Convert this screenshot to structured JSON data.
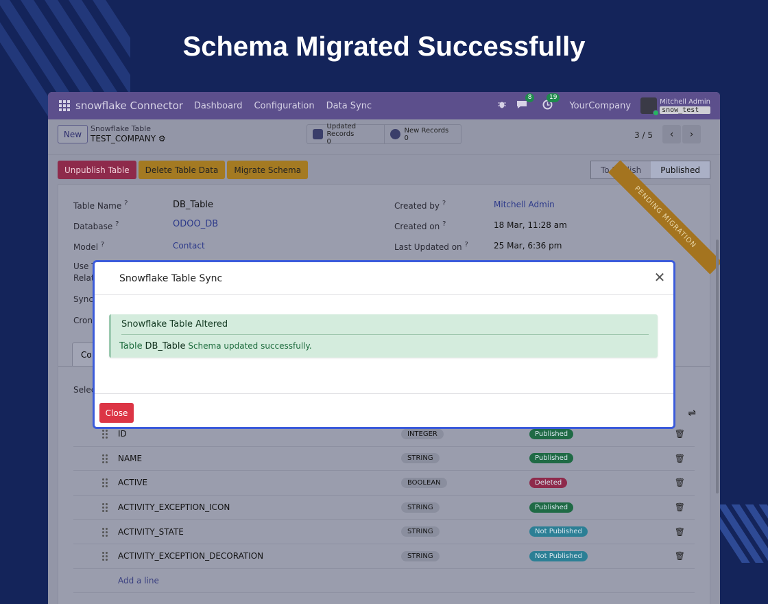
{
  "headline": "Schema Migrated Successfully",
  "navbar": {
    "brand": "snowflake Connector",
    "menu": [
      "Dashboard",
      "Configuration",
      "Data Sync"
    ],
    "messages_count": "8",
    "activities_count": "19",
    "company": "YourCompany",
    "user_name": "Mitchell Admin",
    "db_name": "snow_test",
    "icons": {
      "apps": "apps-grid-icon",
      "debug": "bug-icon",
      "messages": "chat-icon",
      "activities": "clock-icon"
    }
  },
  "control": {
    "new_label": "New",
    "breadcrumb_parent": "Snowflake Table",
    "breadcrumb_current": "TEST_COMPANY",
    "stats": [
      {
        "label": "Updated Records",
        "value": "0",
        "icon": "edit-icon"
      },
      {
        "label": "New Records",
        "value": "0",
        "icon": "plus-circle-icon"
      }
    ],
    "pager_current": "3",
    "pager_total": "/ 5"
  },
  "actions": {
    "unpublish": "Unpublish Table",
    "delete": "Delete Table Data",
    "migrate": "Migrate Schema"
  },
  "statusbar": {
    "to_publish": "To Publish",
    "published": "Published"
  },
  "ribbon": "PENDING MIGRATION",
  "form": {
    "table_name_label": "Table Name",
    "table_name_value": "DB_Table",
    "database_label": "Database",
    "database_value": "ODOO_DB",
    "model_label": "Model",
    "model_value": "Contact",
    "use_label": "Use T",
    "rela_label": "Relat",
    "sync_label": "Sync",
    "cron_label": "Cron",
    "created_by_label": "Created by",
    "created_by_value": "Mitchell Admin",
    "created_on_label": "Created on",
    "created_on_value": "18 Mar, 11:28 am",
    "updated_label": "Last Updated on",
    "updated_value": "25 Mar, 6:36 pm",
    "help_mark": "?",
    "tab_label": "Co",
    "select_label": "Selec"
  },
  "columns": [
    {
      "name": "ID",
      "type": "INTEGER",
      "status": "Published"
    },
    {
      "name": "NAME",
      "type": "STRING",
      "status": "Published"
    },
    {
      "name": "ACTIVE",
      "type": "BOOLEAN",
      "status": "Deleted"
    },
    {
      "name": "ACTIVITY_EXCEPTION_ICON",
      "type": "STRING",
      "status": "Published"
    },
    {
      "name": "ACTIVITY_STATE",
      "type": "STRING",
      "status": "Not Published"
    },
    {
      "name": "ACTIVITY_EXCEPTION_DECORATION",
      "type": "STRING",
      "status": "Not Published"
    }
  ],
  "add_line": "Add a line",
  "status_colors": {
    "Published": "#1f6a45",
    "Deleted": "#8e2a4b",
    "Not Published": "#2c7f95"
  },
  "modal": {
    "title": "Snowflake Table Sync",
    "alert_title": "Snowflake Table Altered",
    "alert_lead": "Table",
    "alert_table": "DB_Table",
    "alert_text": "Schema updated successfully.",
    "close_label": "Close"
  }
}
